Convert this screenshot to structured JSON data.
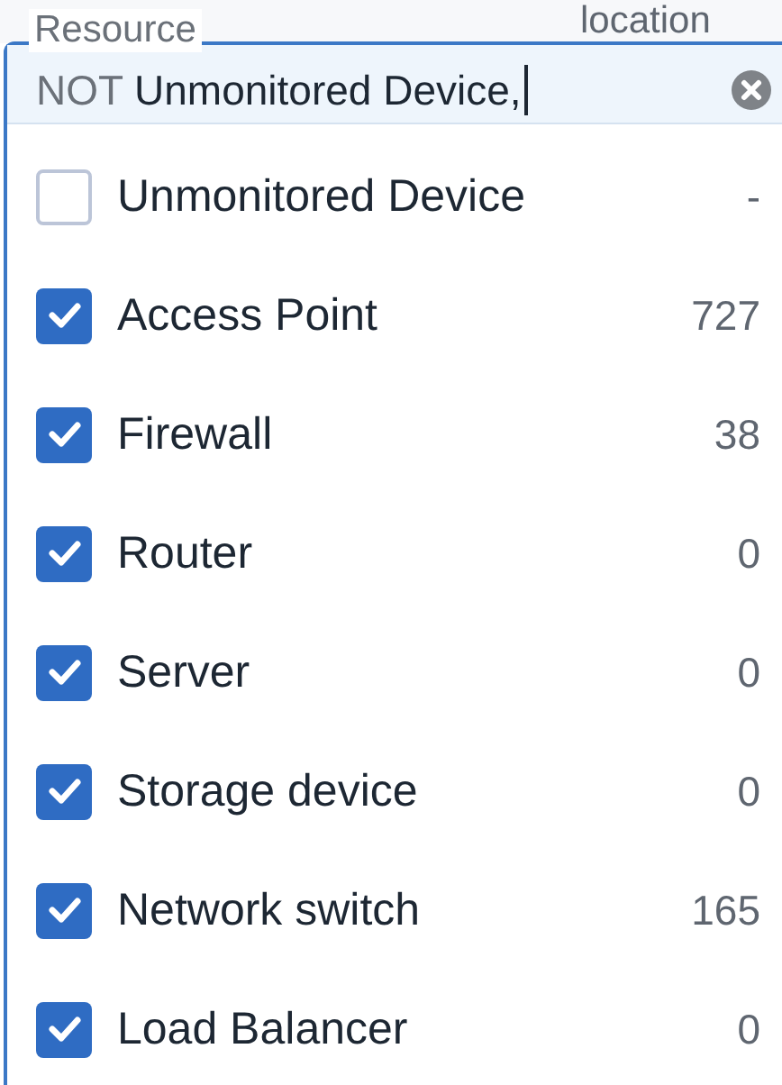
{
  "background_column": {
    "label": "location"
  },
  "field": {
    "label": "Resource",
    "prefix": "NOT",
    "value": "Unmonitored Device,"
  },
  "options": [
    {
      "label": "Unmonitored Device",
      "count": "-",
      "checked": false
    },
    {
      "label": "Access Point",
      "count": "727",
      "checked": true
    },
    {
      "label": "Firewall",
      "count": "38",
      "checked": true
    },
    {
      "label": "Router",
      "count": "0",
      "checked": true
    },
    {
      "label": "Server",
      "count": "0",
      "checked": true
    },
    {
      "label": "Storage device",
      "count": "0",
      "checked": true
    },
    {
      "label": "Network switch",
      "count": "165",
      "checked": true
    },
    {
      "label": "Load Balancer",
      "count": "0",
      "checked": true
    }
  ]
}
